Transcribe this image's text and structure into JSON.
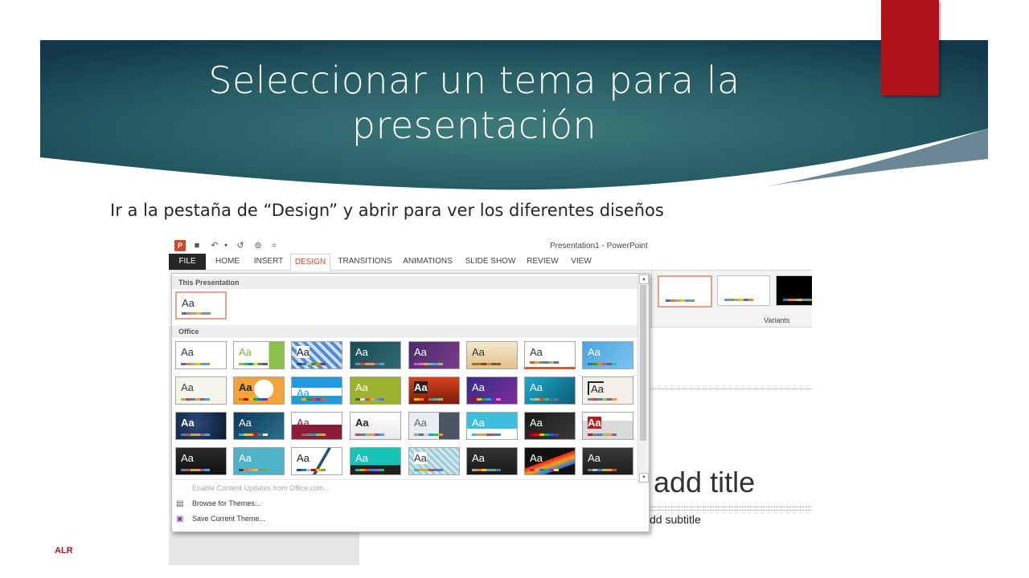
{
  "slide": {
    "title_line1": "Seleccionar un tema para la",
    "title_line2": "presentación",
    "subtitle": "Ir a la pestaña de “Design” y abrir para ver los diferentes diseños",
    "footer": "ALR",
    "banner_color": "#1c4a55",
    "accent_color": "#b0141a"
  },
  "app": {
    "title": "Presentation1 - PowerPoint",
    "tabs": [
      "FILE",
      "HOME",
      "INSERT",
      "DESIGN",
      "TRANSITIONS",
      "ANIMATIONS",
      "SLIDE SHOW",
      "REVIEW",
      "VIEW"
    ],
    "active_tab": "DESIGN",
    "variants_label": "Variants"
  },
  "gallery": {
    "this_presentation_label": "This Presentation",
    "office_label": "Office",
    "thumb_text": "Aa",
    "menu": {
      "enable_updates": "Enable Content Updates from Office.com...",
      "browse_themes": "Browse for Themes...",
      "save_theme": "Save Current Theme..."
    }
  },
  "background_slide": {
    "title_fragment": "add title",
    "subtitle_fragment": "dd subtitle"
  }
}
